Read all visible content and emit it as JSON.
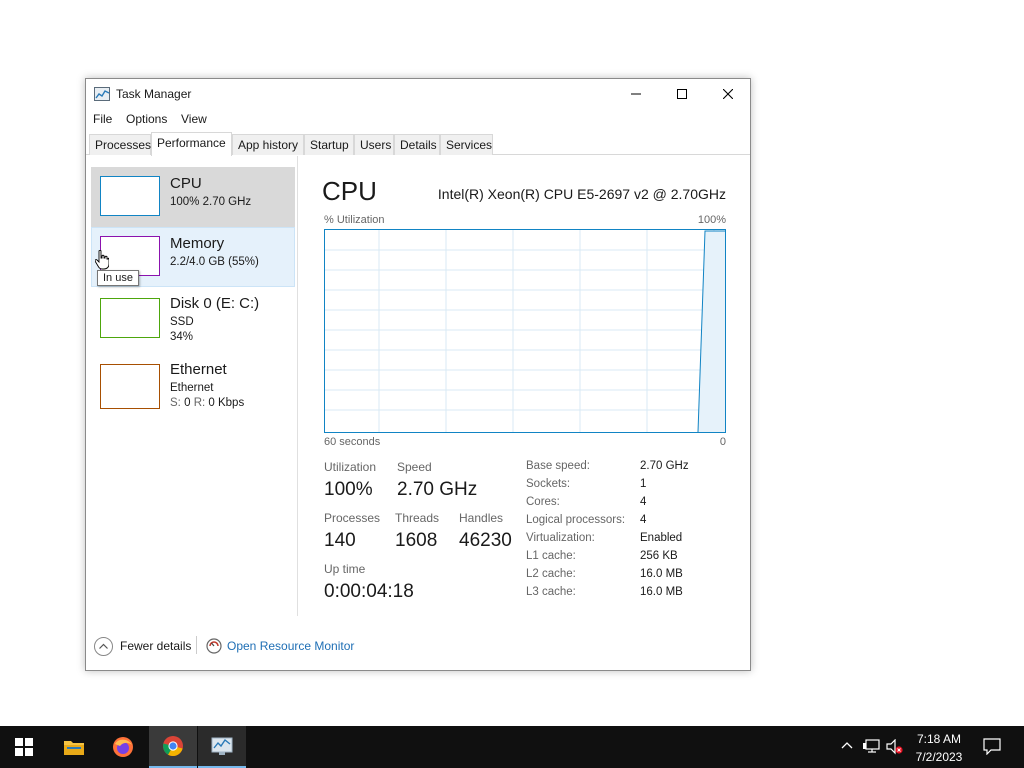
{
  "window": {
    "title": "Task Manager",
    "controls": {
      "minimize": "minimize",
      "maximize": "maximize",
      "close": "close"
    }
  },
  "menu": [
    "File",
    "Options",
    "View"
  ],
  "tabs": [
    "Processes",
    "Performance",
    "App history",
    "Startup",
    "Users",
    "Details",
    "Services"
  ],
  "active_tab": "Performance",
  "sidebar": {
    "items": [
      {
        "title": "CPU",
        "line1": "100% 2.70 GHz",
        "line2": "",
        "color": "#1184c4",
        "state": "selected"
      },
      {
        "title": "Memory",
        "line1": "2.2/4.0 GB (55%)",
        "line2": "",
        "color": "#8b12ae",
        "state": "hover"
      },
      {
        "title": "Disk 0 (E: C:)",
        "line1": "SSD",
        "line2": "34%",
        "color": "#4da60c",
        "state": "normal"
      },
      {
        "title": "Ethernet",
        "line1": "Ethernet",
        "line2_prefix_s": "S:",
        "line2_s_val": "0",
        "line2_prefix_r": "R:",
        "line2_r_val": "0 Kbps",
        "color": "#a74f01",
        "state": "normal"
      }
    ],
    "tooltip": "In use"
  },
  "cpu_panel": {
    "heading": "CPU",
    "model": "Intel(R) Xeon(R) CPU E5-2697 v2 @ 2.70GHz",
    "graph_label": "% Utilization",
    "graph_max": "100%",
    "axis_left": "60 seconds",
    "axis_right": "0",
    "graph_color": "#1184c4",
    "stats": {
      "utilization_label": "Utilization",
      "utilization": "100%",
      "speed_label": "Speed",
      "speed": "2.70 GHz",
      "processes_label": "Processes",
      "processes": "140",
      "threads_label": "Threads",
      "threads": "1608",
      "handles_label": "Handles",
      "handles": "46230",
      "uptime_label": "Up time",
      "uptime": "0:00:04:18"
    },
    "specs": [
      {
        "key": "Base speed:",
        "value": "2.70 GHz"
      },
      {
        "key": "Sockets:",
        "value": "1"
      },
      {
        "key": "Cores:",
        "value": "4"
      },
      {
        "key": "Logical processors:",
        "value": "4"
      },
      {
        "key": "Virtualization:",
        "value": "Enabled"
      },
      {
        "key": "L1 cache:",
        "value": "256 KB"
      },
      {
        "key": "L2 cache:",
        "value": "16.0 MB"
      },
      {
        "key": "L3 cache:",
        "value": "16.0 MB"
      }
    ]
  },
  "footer": {
    "fewer_details": "Fewer details",
    "open_resource_monitor": "Open Resource Monitor"
  },
  "taskbar": {
    "apps": [
      "start-icon",
      "file-explorer-icon",
      "firefox-icon",
      "chrome-icon",
      "task-manager-icon"
    ],
    "clock_time": "7:18 AM",
    "clock_date": "7/2/2023"
  }
}
